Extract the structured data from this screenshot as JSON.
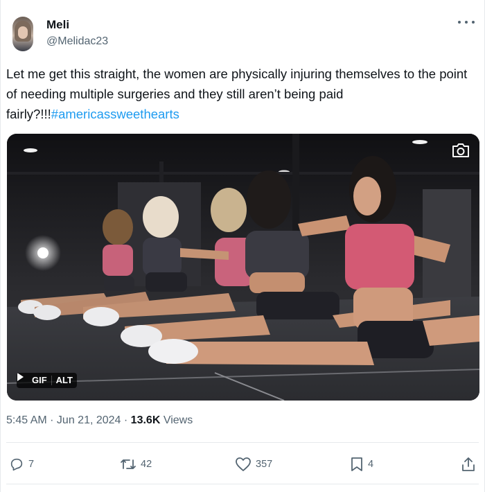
{
  "author": {
    "name": "Meli",
    "handle": "@Melidac23"
  },
  "tweet": {
    "text": "Let me get this straight, the women are physically injuring themselves to the point of needing multiple surgeries and they still aren’t being paid fairly?!!!",
    "hashtag": "#americassweethearts"
  },
  "media": {
    "type_label": "GIF",
    "alt_label": "ALT"
  },
  "meta": {
    "time": "5:45 AM",
    "dot1": " · ",
    "date": "Jun 21, 2024",
    "dot2": " · ",
    "views_count": "13.6K",
    "views_label": " Views"
  },
  "actions": {
    "replies": "7",
    "reposts": "42",
    "likes": "357",
    "bookmarks": "4"
  },
  "colors": {
    "accent": "#1d9bf0",
    "secondary_text": "#536471",
    "primary_text": "#0f1419"
  },
  "icons": [
    "more-icon",
    "camera-icon",
    "play-icon",
    "reply-icon",
    "repost-icon",
    "like-icon",
    "bookmark-icon",
    "share-icon"
  ]
}
